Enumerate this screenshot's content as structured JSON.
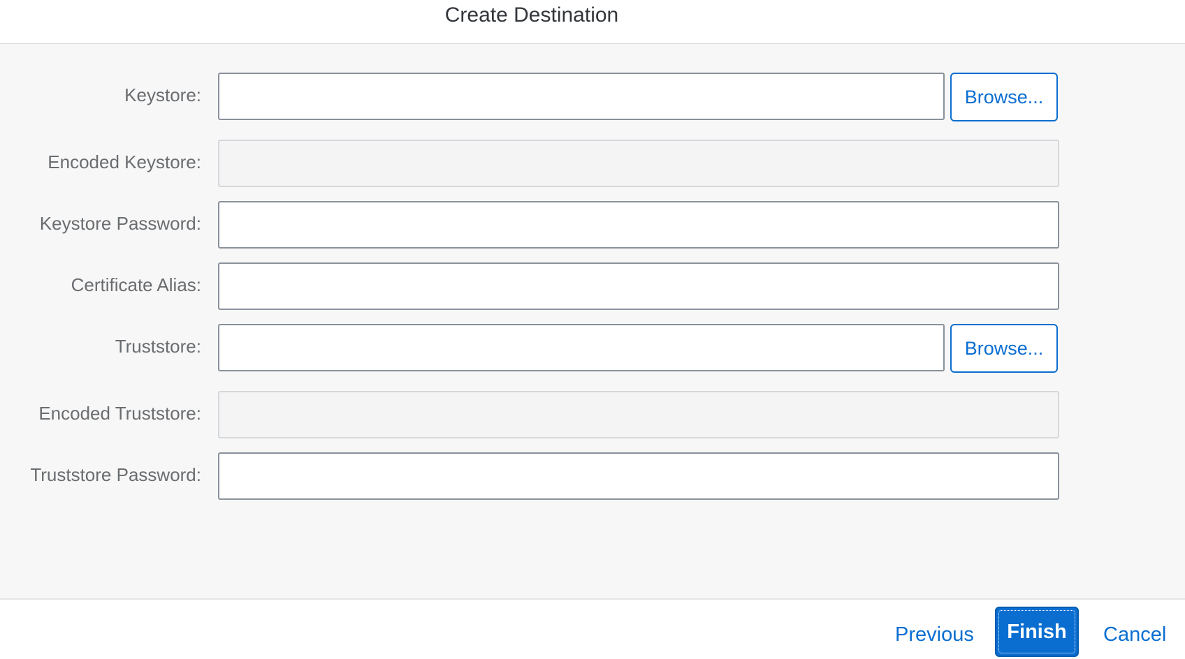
{
  "dialog": {
    "title": "Create Destination"
  },
  "form": {
    "keystore": {
      "label": "Keystore:",
      "value": "",
      "browse_label": "Browse..."
    },
    "encoded_keystore": {
      "label": "Encoded Keystore:",
      "value": ""
    },
    "keystore_password": {
      "label": "Keystore Password:",
      "value": ""
    },
    "certificate_alias": {
      "label": "Certificate Alias:",
      "value": ""
    },
    "truststore": {
      "label": "Truststore:",
      "value": "",
      "browse_label": "Browse..."
    },
    "encoded_truststore": {
      "label": "Encoded Truststore:",
      "value": ""
    },
    "truststore_password": {
      "label": "Truststore Password:",
      "value": ""
    }
  },
  "footer": {
    "previous_label": "Previous",
    "finish_label": "Finish",
    "cancel_label": "Cancel"
  },
  "colors": {
    "accent": "#0a6ed1",
    "content_background": "#f7f7f7",
    "label_text": "#6a6d70",
    "title_text": "#32363a",
    "field_border": "#89919a",
    "readonly_background": "#f4f4f4"
  }
}
